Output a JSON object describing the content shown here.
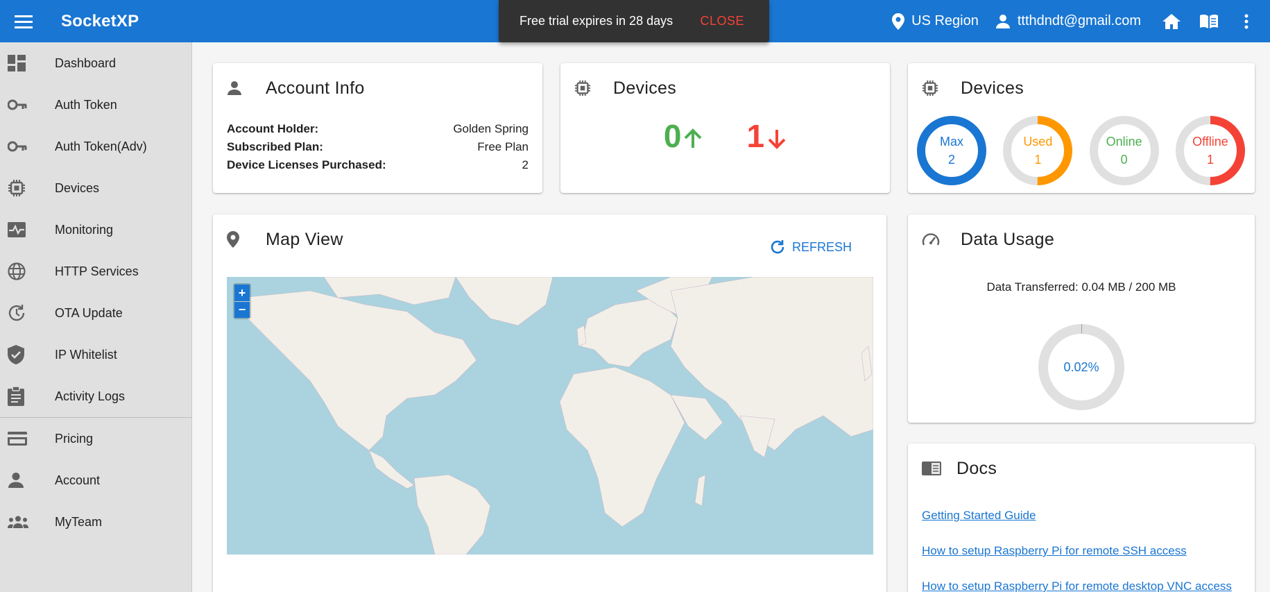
{
  "header": {
    "brand": "SocketXP",
    "region": "US Region",
    "email": "ttthdndt@gmail.com"
  },
  "snackbar": {
    "message": "Free trial expires in 28 days",
    "close_label": "CLOSE"
  },
  "sidebar": {
    "items": [
      {
        "label": "Dashboard",
        "icon": "dashboard-icon"
      },
      {
        "label": "Auth Token",
        "icon": "key-icon"
      },
      {
        "label": "Auth Token(Adv)",
        "icon": "key-icon"
      },
      {
        "label": "Devices",
        "icon": "chip-icon"
      },
      {
        "label": "Monitoring",
        "icon": "monitoring-icon"
      },
      {
        "label": "HTTP Services",
        "icon": "globe-icon"
      },
      {
        "label": "OTA Update",
        "icon": "update-icon"
      },
      {
        "label": "IP Whitelist",
        "icon": "shield-icon"
      },
      {
        "label": "Activity Logs",
        "icon": "clipboard-icon"
      },
      {
        "label": "Pricing",
        "icon": "credit-card-icon"
      },
      {
        "label": "Account",
        "icon": "person-icon"
      },
      {
        "label": "MyTeam",
        "icon": "group-icon"
      }
    ]
  },
  "account_info": {
    "title": "Account Info",
    "rows": [
      {
        "key": "Account Holder:",
        "value": "Golden Spring"
      },
      {
        "key": "Subscribed Plan:",
        "value": "Free Plan"
      },
      {
        "key": "Device Licenses Purchased:",
        "value": "2"
      }
    ]
  },
  "devices_counts": {
    "title": "Devices",
    "online": "0",
    "offline": "1"
  },
  "devices_rings": {
    "title": "Devices",
    "rings": [
      {
        "label": "Max",
        "value": "2",
        "fraction": 1.0,
        "color": "#1976d2"
      },
      {
        "label": "Used",
        "value": "1",
        "fraction": 0.5,
        "color": "#ff9800"
      },
      {
        "label": "Online",
        "value": "0",
        "fraction": 0.0,
        "color": "#4caf50"
      },
      {
        "label": "Offline",
        "value": "1",
        "fraction": 0.5,
        "color": "#f44336"
      }
    ]
  },
  "map_view": {
    "title": "Map View",
    "refresh_label": "REFRESH",
    "zoom_in": "+",
    "zoom_out": "−"
  },
  "data_usage": {
    "title": "Data Usage",
    "transferred": "Data Transferred: 0.04 MB / 200 MB",
    "percent_label": "0.02%",
    "fraction": 0.0002
  },
  "docs": {
    "title": "Docs",
    "links": [
      "Getting Started Guide",
      "How to setup Raspberry Pi for remote SSH access",
      "How to setup Raspberry Pi for remote desktop VNC access"
    ]
  },
  "colors": {
    "primary": "#1976d2",
    "online": "#4caf50",
    "offline": "#f44336",
    "used": "#ff9800"
  }
}
